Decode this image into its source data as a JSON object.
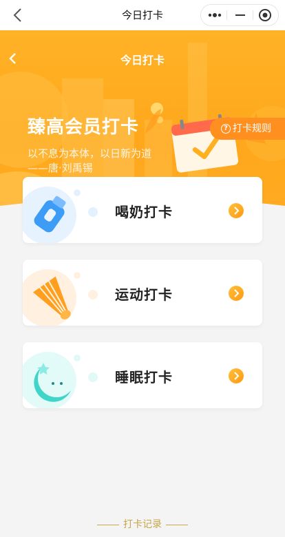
{
  "navbar": {
    "title": "今日打卡"
  },
  "hero": {
    "title": "今日打卡",
    "heading": "臻高会员打卡",
    "quote_line1": "以不息为本体，以日新为道",
    "quote_line2": "——唐·刘禹锡",
    "rules_label": "打卡规则"
  },
  "cards": [
    {
      "label": "喝奶打卡",
      "icon": "milk-bottle-icon",
      "color": "#4aa8ff"
    },
    {
      "label": "运动打卡",
      "icon": "shuttlecock-icon",
      "color": "#ff9a1f"
    },
    {
      "label": "睡眠打卡",
      "icon": "moon-icon",
      "color": "#3fd6c9"
    }
  ],
  "footer": {
    "record_label": "打卡记录"
  },
  "colors": {
    "accent": "#ffa81c",
    "rules_bg": "#ff8f1f",
    "record_text": "#c9a54a"
  }
}
